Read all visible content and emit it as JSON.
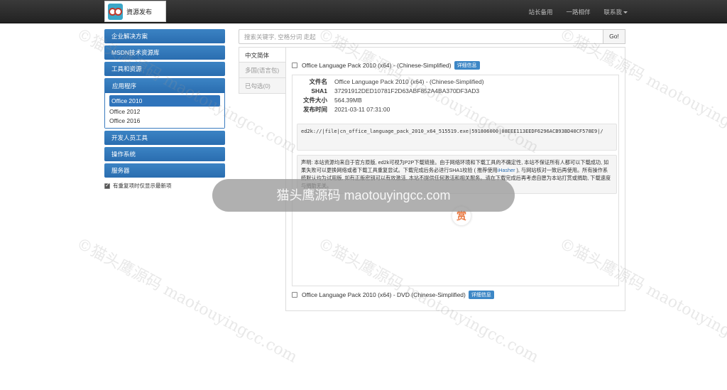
{
  "navbar": {
    "logo_text": "資源发布",
    "links": [
      "站长备用",
      "一路相伴",
      "联系我"
    ]
  },
  "sidebar": {
    "items": [
      {
        "label": "企业解决方案"
      },
      {
        "label": "MSDN技术资源库"
      },
      {
        "label": "工具和资源"
      },
      {
        "label": "应用程序",
        "sub": [
          "Office 2010",
          "Office 2012",
          "Office 2016"
        ]
      },
      {
        "label": "开发人员工具"
      },
      {
        "label": "操作系统"
      },
      {
        "label": "服务器"
      }
    ],
    "checkbox_label": "有重复项时仅显示最新项"
  },
  "search": {
    "placeholder": "搜索关键字, 空格分词 走起",
    "button": "Go!"
  },
  "tabs": [
    "中文简体",
    "多国(语言包)",
    "已勾选(0)"
  ],
  "items": [
    {
      "title": "Office Language Pack 2010 (x64) - (Chinese-Simplified)",
      "badge": "详细信息"
    },
    {
      "title": "Office Language Pack 2010 (x64) - DVD (Chinese-Simplified)",
      "badge": "详细信息"
    }
  ],
  "detail": {
    "meta": [
      {
        "key": "文件名",
        "value": "Office Language Pack 2010 (x64) - (Chinese-Simplified)"
      },
      {
        "key": "SHA1",
        "value": "37291912DED10781F2D63ABF852A4BA370DF3AD3"
      },
      {
        "key": "文件大小",
        "value": "564.39MB"
      },
      {
        "key": "发布时间",
        "value": "2021-03-11 07:31:00"
      }
    ],
    "ed2k": "ed2k://|file|cn_office_language_pack_2010_x64_515519.exe|591806000|08EEE113EEDF6296ACB93BD40CF578E9|/",
    "notice_part1": "声明: 本站资源均来自于官方原版, ed2k可视为P2P下载链接。由于网络环境和下载工具的不确定性, 本站不保证所有人都可以下载成功, 如果失败可以更换网络或者下载工具重复尝试。下载完成后务必进行SHA1校验 ( 推荐使用",
    "notice_link": "iHasher",
    "notice_part2": " ), 与网站核对一致后再使用。所有操作系统默认均为试用版, 如有正版密钥可以有效激活, 本站不提供任何激活和相关服务。请在下载完成后再考虑自愿为本站打赏或捐助, 下载速度与捐助无关。",
    "reward": "赏"
  },
  "watermark": "©猫头鹰源码 maotouyingcc.com",
  "overlay_text": "猫头鹰源码 maotouyingcc.com"
}
